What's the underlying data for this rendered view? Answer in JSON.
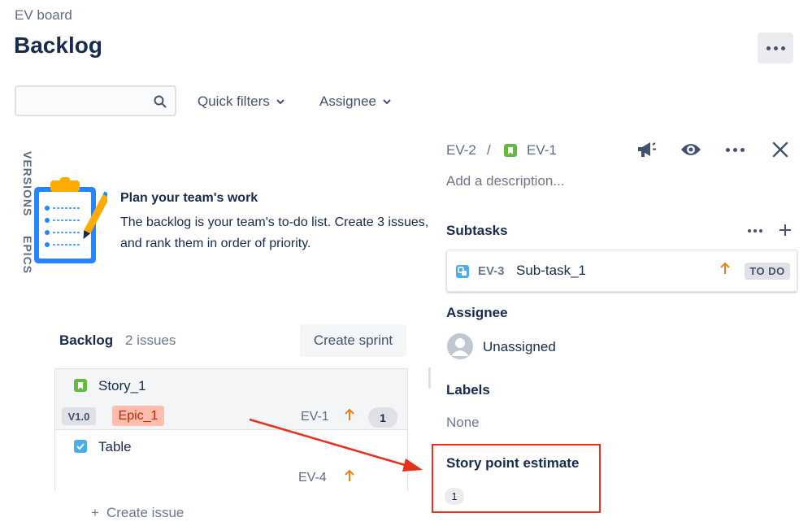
{
  "board": {
    "name": "EV board"
  },
  "page": {
    "title": "Backlog"
  },
  "toolbar": {
    "search_placeholder": "",
    "quick_filters_label": "Quick filters",
    "assignee_label": "Assignee"
  },
  "side_tabs": {
    "versions": "VERSIONS",
    "epics": "EPICS"
  },
  "empty_state": {
    "title": "Plan your team's work",
    "description": "The backlog is your team's to-do list. Create 3 issues, and rank them in order of priority."
  },
  "backlog": {
    "label": "Backlog",
    "count": "2 issues",
    "create_sprint_label": "Create sprint",
    "issues": [
      {
        "summary": "Story_1",
        "type_icon": "story-icon",
        "version": "V1.0",
        "epic": "Epic_1",
        "key": "EV-1",
        "priority_icon": "priority-high-arrow-icon",
        "points": "1"
      },
      {
        "summary": "Table",
        "type_icon": "task-checkbox-icon",
        "key": "EV-4",
        "priority_icon": "priority-high-arrow-icon"
      }
    ],
    "create_issue_label": "Create issue"
  },
  "detail": {
    "breadcrumb": {
      "parent_key": "EV-2",
      "separator": "/",
      "issue_key": "EV-1"
    },
    "icons": [
      "megaphone-icon",
      "watch-eye-icon",
      "more-icon",
      "close-icon"
    ],
    "description_placeholder": "Add a description...",
    "subtasks_heading": "Subtasks",
    "subtasks": [
      {
        "key": "EV-3",
        "summary": "Sub-task_1",
        "priority_icon": "priority-high-arrow-icon",
        "status": "TO DO"
      }
    ],
    "assignee_heading": "Assignee",
    "assignee_value": "Unassigned",
    "labels_heading": "Labels",
    "labels_value": "None",
    "story_point_heading": "Story point estimate",
    "story_point_value": "1"
  },
  "annotation": {
    "color": "#e8301c"
  },
  "colors": {
    "text_primary": "#172b4d",
    "text_subtle": "#5e6c84",
    "story": "#63ba3c",
    "task": "#4bade8",
    "priority": "#e8801c",
    "epic_bg": "#ffbdad",
    "epic_text": "#bf2600"
  }
}
